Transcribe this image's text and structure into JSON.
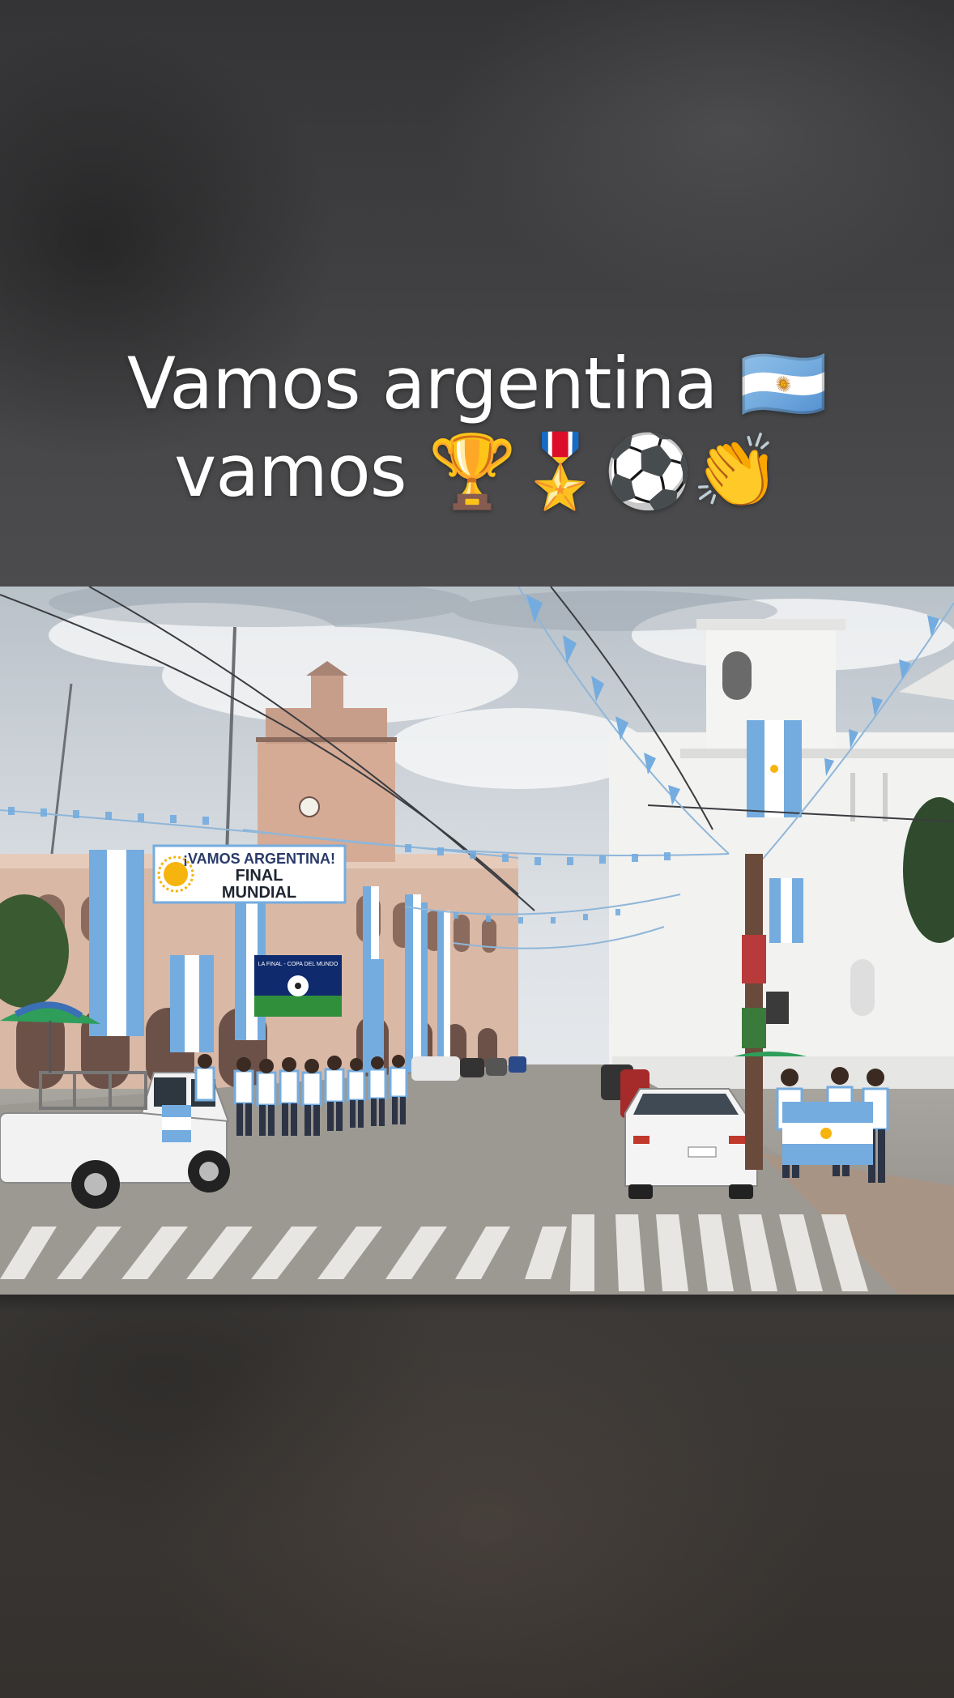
{
  "caption": {
    "line1": "Vamos argentina 🇦🇷",
    "line2": "vamos 🏆🎖️⚽👏"
  },
  "photo": {
    "banner_main": {
      "line1": "¡VAMOS ARGENTINA!",
      "line2": "FINAL",
      "line3": "MUNDIAL"
    },
    "screen_text": "LA FINAL - COPA DEL MUNDO",
    "colors": {
      "sky_blue": "#74acdf",
      "white": "#ffffff",
      "sun": "#f6b40e"
    }
  }
}
